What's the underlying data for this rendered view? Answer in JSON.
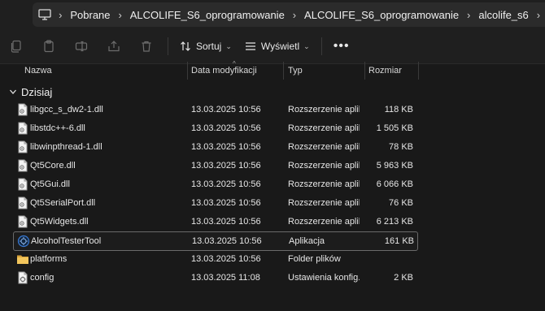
{
  "breadcrumb": [
    "Pobrane",
    "ALCOLIFE_S6_oprogramowanie",
    "ALCOLIFE_S6_oprogramowanie",
    "alcolife_s6"
  ],
  "toolbar": {
    "sort_label": "Sortuj",
    "view_label": "Wyświetl",
    "more_label": "•••"
  },
  "columns": {
    "name": "Nazwa",
    "date": "Data modyfikacji",
    "type": "Typ",
    "size": "Rozmiar"
  },
  "group": {
    "label": "Dzisiaj"
  },
  "files": [
    {
      "name": "libgcc_s_dw2-1.dll",
      "date": "13.03.2025 10:56",
      "type": "Rozszerzenie aplik...",
      "size": "118 KB",
      "icon": "dll-file-icon"
    },
    {
      "name": "libstdc++-6.dll",
      "date": "13.03.2025 10:56",
      "type": "Rozszerzenie aplik...",
      "size": "1 505 KB",
      "icon": "dll-file-icon"
    },
    {
      "name": "libwinpthread-1.dll",
      "date": "13.03.2025 10:56",
      "type": "Rozszerzenie aplik...",
      "size": "78 KB",
      "icon": "dll-file-icon"
    },
    {
      "name": "Qt5Core.dll",
      "date": "13.03.2025 10:56",
      "type": "Rozszerzenie aplik...",
      "size": "5 963 KB",
      "icon": "dll-file-icon"
    },
    {
      "name": "Qt5Gui.dll",
      "date": "13.03.2025 10:56",
      "type": "Rozszerzenie aplik...",
      "size": "6 066 KB",
      "icon": "dll-file-icon"
    },
    {
      "name": "Qt5SerialPort.dll",
      "date": "13.03.2025 10:56",
      "type": "Rozszerzenie aplik...",
      "size": "76 KB",
      "icon": "dll-file-icon"
    },
    {
      "name": "Qt5Widgets.dll",
      "date": "13.03.2025 10:56",
      "type": "Rozszerzenie aplik...",
      "size": "6 213 KB",
      "icon": "dll-file-icon"
    },
    {
      "name": "AlcoholTesterTool",
      "date": "13.03.2025 10:56",
      "type": "Aplikacja",
      "size": "161 KB",
      "icon": "app-icon",
      "selected": true
    },
    {
      "name": "platforms",
      "date": "13.03.2025 10:56",
      "type": "Folder plików",
      "size": "",
      "icon": "folder-icon"
    },
    {
      "name": "config",
      "date": "13.03.2025 11:08",
      "type": "Ustawienia konfig...",
      "size": "2 KB",
      "icon": "config-file-icon"
    }
  ],
  "colors": {
    "background": "#191919",
    "folder": "#e8b84a",
    "app_icon": "#3a7bd5"
  }
}
